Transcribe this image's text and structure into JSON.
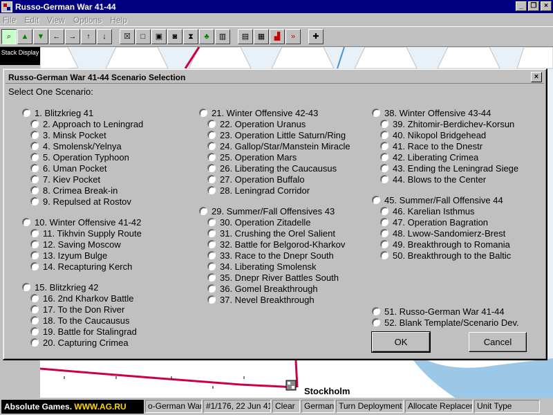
{
  "window": {
    "title": "Russo-German War 41-44"
  },
  "menu": [
    "File",
    "Edit",
    "View",
    "Options",
    "Help"
  ],
  "toolbar": [
    {
      "icon": "magnifier-icon",
      "glyph": "⌕"
    },
    {
      "icon": "triangle-up-icon",
      "glyph": "▲"
    },
    {
      "icon": "triangle-down-icon",
      "glyph": "▼"
    },
    {
      "icon": "arrow-left-icon",
      "glyph": "←"
    },
    {
      "icon": "arrow-right-icon",
      "glyph": "→"
    },
    {
      "icon": "arrow-up-icon",
      "glyph": "↑"
    },
    {
      "icon": "arrow-down-icon",
      "glyph": "↓"
    },
    {
      "icon": "box-x-icon",
      "glyph": "☒"
    },
    {
      "icon": "box-yellow-icon",
      "glyph": "□"
    },
    {
      "icon": "box-dots-icon",
      "glyph": "▣"
    },
    {
      "icon": "box-person-icon",
      "glyph": "◙"
    },
    {
      "icon": "box-hourglass-icon",
      "glyph": "⧗"
    },
    {
      "icon": "tree-icon",
      "glyph": "♣"
    },
    {
      "icon": "city-icon",
      "glyph": "▥"
    },
    {
      "icon": "notepad-icon",
      "glyph": "▤"
    },
    {
      "icon": "save-icon",
      "glyph": "▦"
    },
    {
      "icon": "steps-icon",
      "glyph": "▟"
    },
    {
      "icon": "fast-forward-icon",
      "glyph": "»"
    },
    {
      "icon": "iron-cross-icon",
      "glyph": "✚"
    }
  ],
  "stack_display": "Stack Display",
  "map": {
    "city_label": "Stockholm"
  },
  "dialog": {
    "title": "Russo-German War 41-44 Scenario Selection",
    "close": "×",
    "prompt": "Select One Scenario:",
    "columns": [
      [
        {
          "header": "1.  Blitzkrieg 41",
          "items": [
            "2.  Approach to Leningrad",
            "3.  Minsk Pocket",
            "4.  Smolensk/Yelnya",
            "5.  Operation Typhoon",
            "6.  Uman Pocket",
            "7.  Kiev Pocket",
            "8.  Crimea Break-in",
            "9.  Repulsed at Rostov"
          ]
        },
        {
          "header": "10. Winter Offensive 41-42",
          "items": [
            "11. Tikhvin Supply Route",
            "12. Saving Moscow",
            "13. Izyum Bulge",
            "14. Recapturing Kerch"
          ]
        },
        {
          "header": "15. Blitzkrieg 42",
          "items": [
            "16. 2nd Kharkov Battle",
            "17. To the Don River",
            "18. To the Caucausus",
            "19. Battle for Stalingrad",
            "20. Capturing Crimea"
          ]
        }
      ],
      [
        {
          "header": "21. Winter Offensive 42-43",
          "items": [
            "22. Operation Uranus",
            "23. Operation Little Saturn/Ring",
            "24. Gallop/Star/Manstein Miracle",
            "25. Operation Mars",
            "26. Liberating the Caucausus",
            "27. Operation Buffalo",
            "28. Leningrad Corridor"
          ]
        },
        {
          "header": "29. Summer/Fall Offensives 43",
          "items": [
            "30. Operation Zitadelle",
            "31. Crushing the Orel Salient",
            "32. Battle for Belgorod-Kharkov",
            "33. Race to the Dnepr South",
            "34. Liberating Smolensk",
            "35. Dnepr River Battles South",
            "36. Gomel Breakthrough",
            "37. Nevel Breakthrough"
          ]
        }
      ],
      [
        {
          "header": "38. Winter Offensive 43-44",
          "items": [
            "39. Zhitomir-Berdichev-Korsun",
            "40. Nikopol Bridgehead",
            "41. Race to the Dnestr",
            "42. Liberating Crimea",
            "43. Ending the Leningrad Siege",
            "44. Blows to the Center"
          ]
        },
        {
          "header": "45. Summer/Fall Offensive 44",
          "items": [
            "46. Karelian Isthmus",
            "47. Operation Bagration",
            "48. Lwow-Sandomierz-Brest",
            "49. Breakthrough to Romania",
            "50. Breakthrough to the Baltic"
          ]
        }
      ]
    ],
    "extra": [
      "51. Russo-German War 41-44",
      "52. Blank Template/Scenario Dev."
    ],
    "ok": "OK",
    "cancel": "Cancel"
  },
  "status": {
    "brand": "Absolute Games. ",
    "brand_url": "WWW.AG.RU",
    "cells": [
      "o-German War",
      "#1/176, 22 Jun 41",
      "Clear",
      "German",
      "Turn Deployment",
      "Allocate Replaceme",
      "Unit Type"
    ]
  },
  "colors": {
    "title_bar": "#000080",
    "face": "#c0c0c0",
    "rail": "#cc0044",
    "water": "#e8f0f8"
  }
}
